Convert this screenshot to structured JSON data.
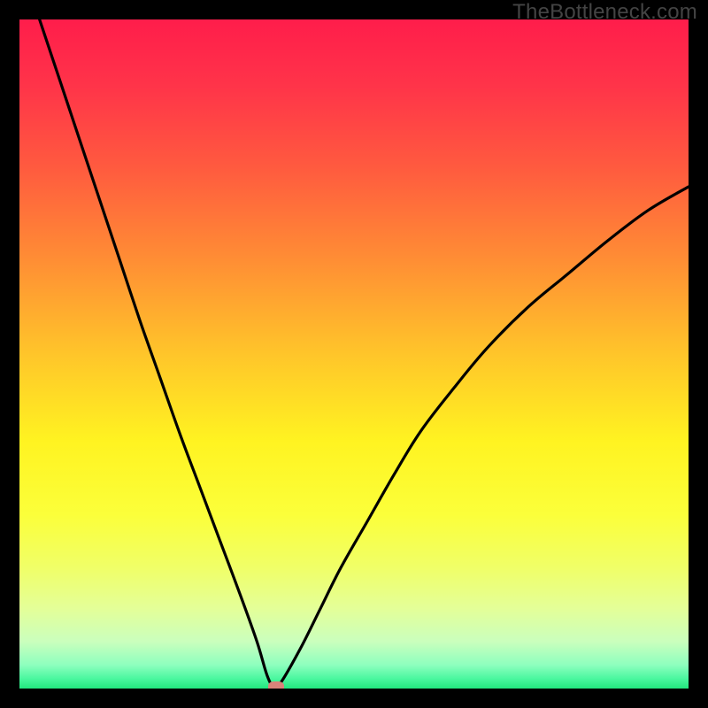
{
  "watermark": "TheBottleneck.com",
  "gradient": {
    "stops": [
      {
        "offset": 0.0,
        "color": "#ff1d4b"
      },
      {
        "offset": 0.1,
        "color": "#ff3449"
      },
      {
        "offset": 0.22,
        "color": "#ff5a3f"
      },
      {
        "offset": 0.35,
        "color": "#ff8a35"
      },
      {
        "offset": 0.5,
        "color": "#ffc52a"
      },
      {
        "offset": 0.63,
        "color": "#fff321"
      },
      {
        "offset": 0.74,
        "color": "#fbff3a"
      },
      {
        "offset": 0.82,
        "color": "#f0ff68"
      },
      {
        "offset": 0.88,
        "color": "#e4ff98"
      },
      {
        "offset": 0.93,
        "color": "#caffbd"
      },
      {
        "offset": 0.965,
        "color": "#8dffbe"
      },
      {
        "offset": 0.985,
        "color": "#4bf79f"
      },
      {
        "offset": 1.0,
        "color": "#22e77e"
      }
    ]
  },
  "chart_data": {
    "type": "line",
    "title": "",
    "xlabel": "",
    "ylabel": "",
    "xlim": [
      0,
      100
    ],
    "ylim": [
      0,
      100
    ],
    "series": [
      {
        "name": "bottleneck-curve",
        "x": [
          3,
          6,
          9,
          12,
          15,
          18,
          21,
          24,
          27,
          30,
          33,
          35.5,
          37,
          38,
          39,
          42,
          45,
          48,
          52,
          56,
          60,
          65,
          70,
          76,
          82,
          88,
          94,
          100
        ],
        "y": [
          100,
          91,
          82,
          73,
          64,
          55,
          46.5,
          38,
          30,
          22,
          14,
          7,
          2,
          0.3,
          0.8,
          6,
          12,
          18,
          25,
          32,
          38.5,
          45,
          51,
          57,
          62,
          67,
          71.5,
          75
        ]
      }
    ],
    "marker": {
      "x": 38.3,
      "y": 0.3
    },
    "legend": [],
    "grid": false
  }
}
